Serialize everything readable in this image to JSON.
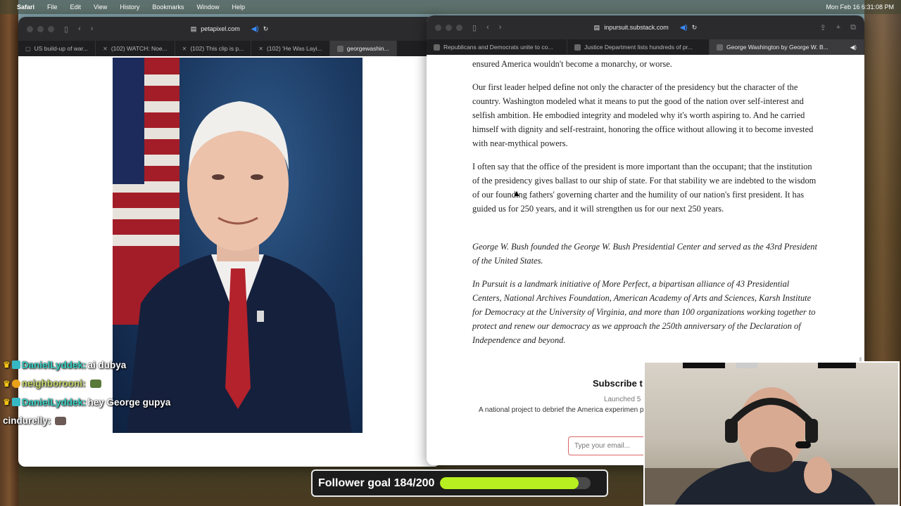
{
  "menubar": {
    "app": "Safari",
    "items": [
      "File",
      "Edit",
      "View",
      "History",
      "Bookmarks",
      "Window",
      "Help"
    ],
    "clock": "Mon Feb 16  6:31:08 PM"
  },
  "left_window": {
    "url": "petapixel.com",
    "tabs": [
      {
        "label": "US build-up of war..."
      },
      {
        "label": "(102) WATCH: Noe..."
      },
      {
        "label": "(102) This clip is p..."
      },
      {
        "label": "(102) 'He Was Layi..."
      },
      {
        "label": "georgewashin..."
      }
    ],
    "active_tab": 4
  },
  "right_window": {
    "url": "inpursuit.substack.com",
    "tabs": [
      {
        "label": "Republicans and Democrats unite to co..."
      },
      {
        "label": "Justice Department lists hundreds of pr..."
      },
      {
        "label": "George Washington by George W. B..."
      }
    ],
    "active_tab": 2,
    "article": {
      "p0": "ensured America wouldn't become a monarchy, or worse.",
      "p1": "Our first leader helped define not only the character of the presidency but the character of the country. Washington modeled what it means to put the good of the nation over self-interest and selfish ambition. He embodied integrity and modeled why it's worth aspiring to. And he carried himself with dignity and self-restraint, honoring the office without allowing it to become invested with near-mythical powers.",
      "p2": "I often say that the office of the president is more important than the occupant; that the institution of the presidency gives ballast to our ship of state. For that stability we are indebted to the wisdom of our founding fathers' governing charter and the humility of our nation's first president. It has guided us for 250 years, and it will strengthen us for our next 250 years.",
      "p3": "George W. Bush founded the George W. Bush Presidential Center and served as the 43rd President of the United States.",
      "p4": "In Pursuit is a landmark initiative of More Perfect, a bipartisan alliance of 43 Presidential Centers, National Archives Foundation, American Academy of Arts and Sciences, Karsh Institute for Democracy at the University of Virginia, and more than 100 organizations working together to protect and renew our democracy as we approach the 250th anniversary of the Declaration of Independence and beyond."
    },
    "subscribe": {
      "title": "Subscribe t",
      "launched": "Launched 5",
      "description": "A national project to debrief the America experimen profit initiative o",
      "email_placeholder": "Type your email..."
    }
  },
  "chat": [
    {
      "user": "DanielLyddek:",
      "message": "ai dubya",
      "name_color": "#37d3c5"
    },
    {
      "user": "neighborooni:",
      "message": "",
      "name_color": "#c9d96a"
    },
    {
      "user": "DanielLyddek:",
      "message": "hey George gupya",
      "name_color": "#37d3c5"
    },
    {
      "user": "cindurelly:",
      "message": "",
      "name_color": "#ffffff"
    }
  ],
  "follower_goal": {
    "label": "Follower goal 184/200",
    "current": 184,
    "target": 200,
    "bar_color": "#b8ef20"
  },
  "icons": [
    "apple-icon",
    "sidebar-icon",
    "back-icon",
    "forward-icon",
    "speaker-icon",
    "reload-icon",
    "share-icon",
    "new-tab-icon",
    "tab-overview-icon",
    "crown-icon"
  ]
}
